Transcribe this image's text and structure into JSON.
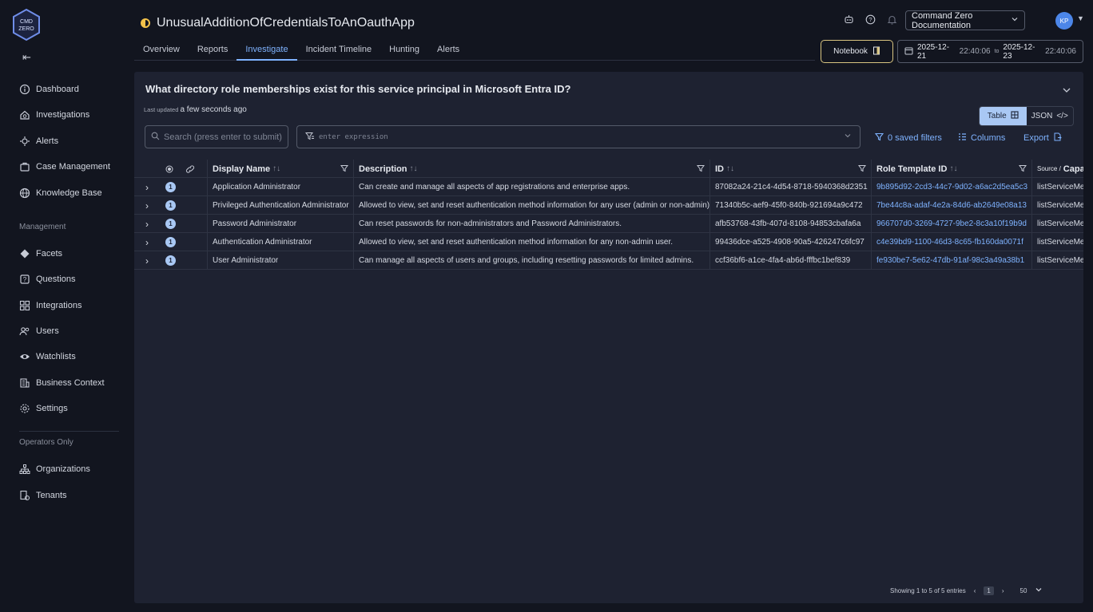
{
  "app": {
    "logo_text": "CMD ZERO",
    "collapse_icon": "collapse-left-icon"
  },
  "sidebar": {
    "items": [
      {
        "label": "Dashboard",
        "icon": "info-circle-icon"
      },
      {
        "label": "Investigations",
        "icon": "search-house-icon"
      },
      {
        "label": "Alerts",
        "icon": "alert-icon"
      },
      {
        "label": "Case Management",
        "icon": "briefcase-icon"
      },
      {
        "label": "Knowledge Base",
        "icon": "globe-icon"
      }
    ],
    "management_label": "Management",
    "management_items": [
      {
        "label": "Facets",
        "icon": "diamond-icon"
      },
      {
        "label": "Questions",
        "icon": "question-box-icon"
      },
      {
        "label": "Integrations",
        "icon": "integrations-icon"
      },
      {
        "label": "Users",
        "icon": "users-icon"
      },
      {
        "label": "Watchlists",
        "icon": "eye-icon"
      },
      {
        "label": "Business Context",
        "icon": "building-icon"
      },
      {
        "label": "Settings",
        "icon": "gear-icon"
      }
    ],
    "operators_label": "Operators Only",
    "operators_items": [
      {
        "label": "Organizations",
        "icon": "org-chart-icon"
      },
      {
        "label": "Tenants",
        "icon": "tenants-icon"
      }
    ]
  },
  "header": {
    "title": "UnusualAdditionOfCredentialsToAnOauthApp",
    "tabs": [
      "Overview",
      "Reports",
      "Investigate",
      "Incident Timeline",
      "Hunting",
      "Alerts"
    ],
    "active_tab": "Investigate",
    "doc_select": "Command Zero Documentation",
    "avatar_initials": "KP",
    "notebook_label": "Notebook",
    "date_from_day": "2025-12-21",
    "date_from_time": "22:40:06",
    "date_to_label": "to",
    "date_to_day": "2025-12-23",
    "date_to_time": "22:40:06"
  },
  "panel": {
    "question": "What directory role memberships exist for this service principal in Microsoft Entra ID?",
    "last_updated_label": "Last updated",
    "last_updated_value": "a few seconds ago",
    "view_table": "Table",
    "view_json": "JSON",
    "search_placeholder": "Search (press enter to submit)",
    "expression_placeholder": "enter expression",
    "saved_filters": "0 saved filters",
    "columns_label": "Columns",
    "export_label": "Export"
  },
  "table": {
    "columns": [
      "Display Name",
      "Description",
      "ID",
      "Role Template ID",
      "Source / Capa"
    ],
    "column_source_prefix": "Source /",
    "column_source_suffix": "Capa",
    "rows": [
      {
        "badge": "1",
        "name": "Application Administrator",
        "description": "Can create and manage all aspects of app registrations and enterprise apps.",
        "id": "87082a24-21c4-4d54-8718-5940368d2351",
        "role_template_id": "9b895d92-2cd3-44c7-9d02-a6ac2d5ea5c3",
        "source": "listServiceMe"
      },
      {
        "badge": "1",
        "name": "Privileged Authentication Administrator",
        "description": "Allowed to view, set and reset authentication method information for any user (admin or non-admin).",
        "id": "71340b5c-aef9-45f0-840b-921694a9c472",
        "role_template_id": "7be44c8a-adaf-4e2a-84d6-ab2649e08a13",
        "source": "listServiceMe"
      },
      {
        "badge": "1",
        "name": "Password Administrator",
        "description": "Can reset passwords for non-administrators and Password Administrators.",
        "id": "afb53768-43fb-407d-8108-94853cbafa6a",
        "role_template_id": "966707d0-3269-4727-9be2-8c3a10f19b9d",
        "source": "listServiceMe"
      },
      {
        "badge": "1",
        "name": "Authentication Administrator",
        "description": "Allowed to view, set and reset authentication method information for any non-admin user.",
        "id": "99436dce-a525-4908-90a5-426247c6fc97",
        "role_template_id": "c4e39bd9-1100-46d3-8c65-fb160da0071f",
        "source": "listServiceMe"
      },
      {
        "badge": "1",
        "name": "User Administrator",
        "description": "Can manage all aspects of users and groups, including resetting passwords for limited admins.",
        "id": "ccf36bf6-a1ce-4fa4-ab6d-fffbc1bef839",
        "role_template_id": "fe930be7-5e62-47db-91af-98c3a49a38b1",
        "source": "listServiceMe"
      }
    ]
  },
  "footer": {
    "showing": "Showing 1 to 5 of 5 entries",
    "page": "1",
    "page_size": "50"
  },
  "colors": {
    "accent": "#7fb3ff",
    "background": "#12151f",
    "panel": "#1e2231",
    "notebook_border": "#d8c480"
  }
}
